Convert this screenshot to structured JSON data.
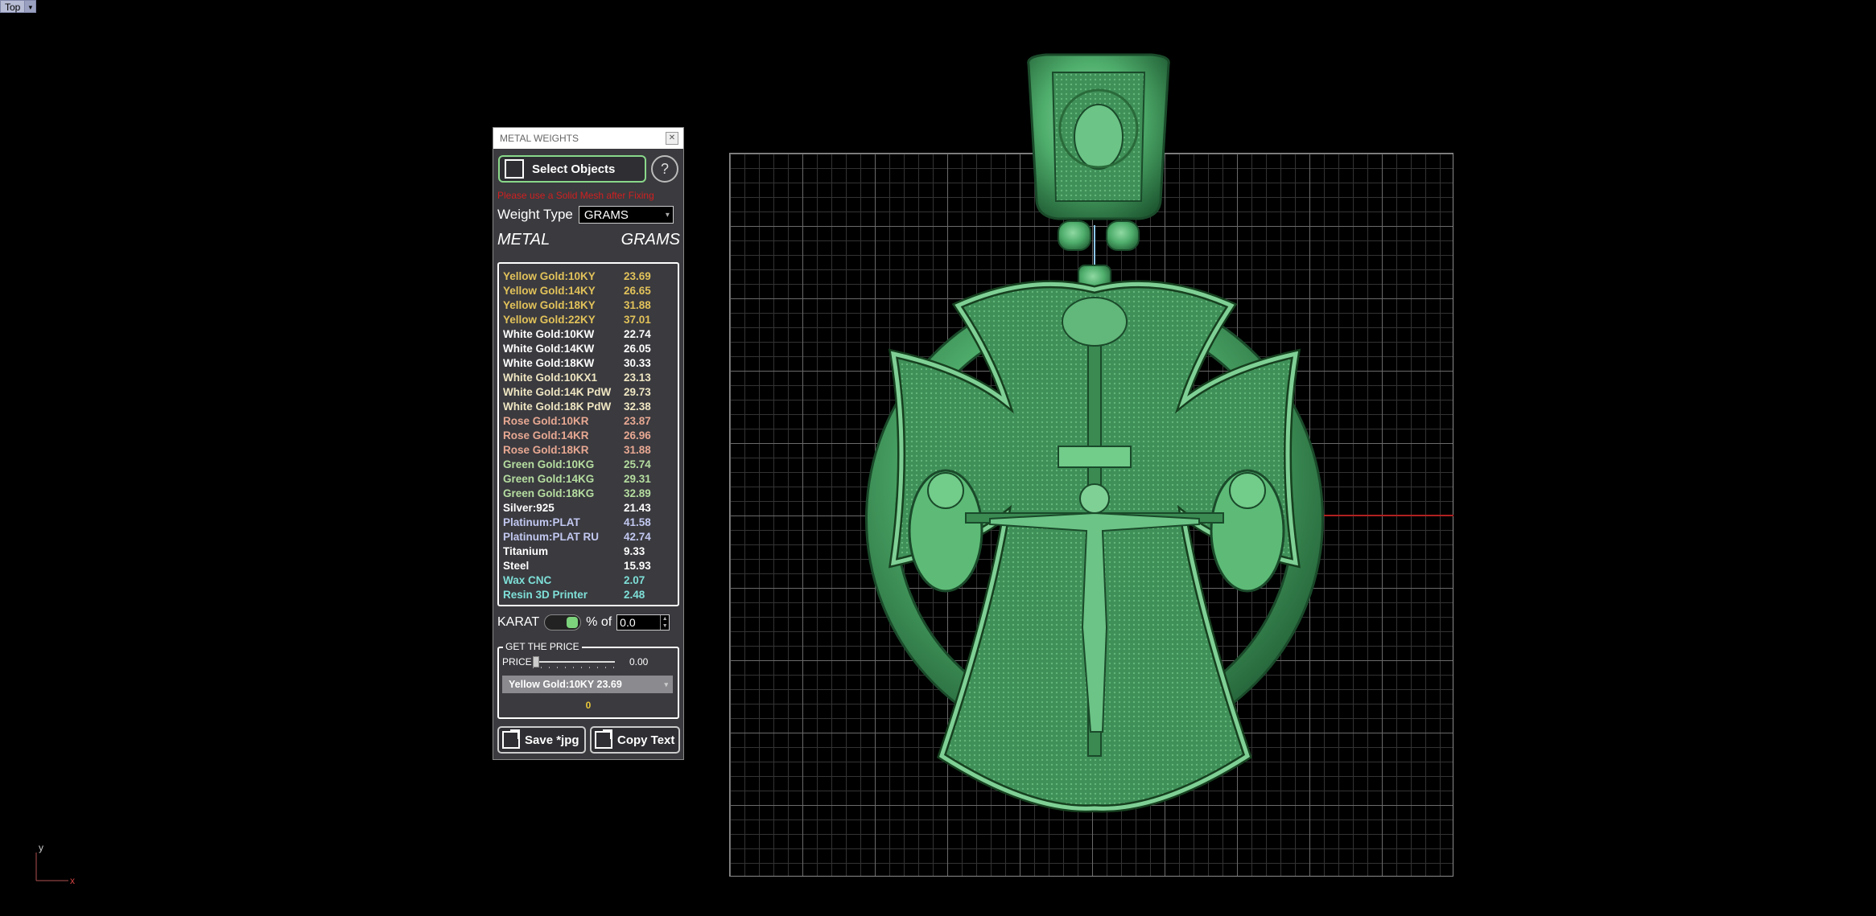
{
  "viewport": {
    "label": "Top",
    "dropdown_glyph": "▾"
  },
  "panel": {
    "title": "METAL WEIGHTS",
    "close_glyph": "✕",
    "select_label": "Select Objects",
    "help_label": "?",
    "warning": "Please use a Solid Mesh after Fixing",
    "weight_type_label": "Weight Type",
    "weight_type_value": "GRAMS",
    "header_metal": "METAL",
    "header_unit": "GRAMS",
    "metals": [
      {
        "name": "Yellow Gold:10KY",
        "value": "23.69",
        "color": "#e2c25a"
      },
      {
        "name": "Yellow Gold:14KY",
        "value": "26.65",
        "color": "#e2c25a"
      },
      {
        "name": "Yellow Gold:18KY",
        "value": "31.88",
        "color": "#e2c25a"
      },
      {
        "name": "Yellow Gold:22KY",
        "value": "37.01",
        "color": "#e2c25a"
      },
      {
        "name": "White Gold:10KW",
        "value": "22.74",
        "color": "#ffffff"
      },
      {
        "name": "White Gold:14KW",
        "value": "26.05",
        "color": "#ffffff"
      },
      {
        "name": "White Gold:18KW",
        "value": "30.33",
        "color": "#ffffff"
      },
      {
        "name": "White Gold:10KX1",
        "value": "23.13",
        "color": "#efe6c2"
      },
      {
        "name": "White Gold:14K PdW",
        "value": "29.73",
        "color": "#efe6c2"
      },
      {
        "name": "White Gold:18K PdW",
        "value": "32.38",
        "color": "#efe6c2"
      },
      {
        "name": "Rose Gold:10KR",
        "value": "23.87",
        "color": "#e8a892"
      },
      {
        "name": "Rose Gold:14KR",
        "value": "26.96",
        "color": "#e8a892"
      },
      {
        "name": "Rose Gold:18KR",
        "value": "31.88",
        "color": "#e8a892"
      },
      {
        "name": "Green Gold:10KG",
        "value": "25.74",
        "color": "#b6dea0"
      },
      {
        "name": "Green Gold:14KG",
        "value": "29.31",
        "color": "#b6dea0"
      },
      {
        "name": "Green Gold:18KG",
        "value": "32.89",
        "color": "#b6dea0"
      },
      {
        "name": "Silver:925",
        "value": "21.43",
        "color": "#ffffff"
      },
      {
        "name": "Platinum:PLAT",
        "value": "41.58",
        "color": "#c2c8f0"
      },
      {
        "name": "Platinum:PLAT RU",
        "value": "42.74",
        "color": "#c2c8f0"
      },
      {
        "name": "Titanium",
        "value": "9.33",
        "color": "#ffffff"
      },
      {
        "name": "Steel",
        "value": "15.93",
        "color": "#ffffff"
      },
      {
        "name": "Wax  CNC",
        "value": "2.07",
        "color": "#7fe0d8"
      },
      {
        "name": "Resin 3D Printer",
        "value": "2.48",
        "color": "#7fe0d8"
      }
    ],
    "karat_label": "KARAT",
    "karat_toggle_on": true,
    "percent_label": "% of",
    "percent_value": "0.0",
    "price_group_label": "GET THE PRICE",
    "price_label": "PRICE",
    "price_slider_value": 0.0,
    "price_value": "0.00",
    "price_metal_selection": "Yellow Gold:10KY 23.69",
    "price_result": "0",
    "save_label": "Save *jpg",
    "copy_label": "Copy Text"
  },
  "axis_indicator": {
    "x": "x",
    "y": "y"
  },
  "colors": {
    "mesh": "#4fae6c",
    "grid_major": "#6a6a6a",
    "x_axis": "#b02020",
    "accent_green": "#7cd37c"
  }
}
